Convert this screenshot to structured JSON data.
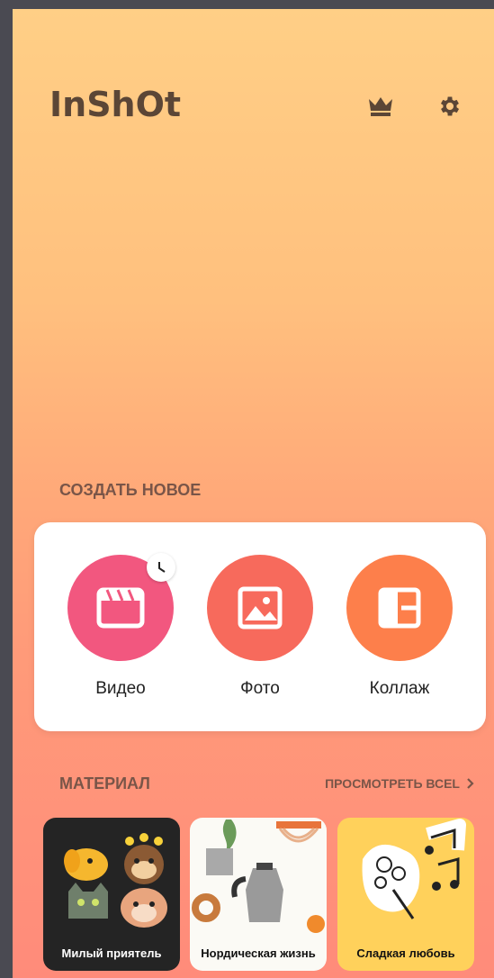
{
  "header": {
    "logo": "InShOt",
    "crown_icon": "crown-icon",
    "settings_icon": "gear-icon"
  },
  "create": {
    "title": "СОЗДАТЬ НОВОЕ",
    "items": [
      {
        "label": "Видео",
        "icon": "clapperboard-icon",
        "badge_icon": "clock-icon",
        "color": "#f2577f"
      },
      {
        "label": "Фото",
        "icon": "image-icon",
        "color": "#f76a5c"
      },
      {
        "label": "Коллаж",
        "icon": "collage-icon",
        "color": "#fd7f4b"
      }
    ]
  },
  "material": {
    "title": "МАТЕРИАЛ",
    "view_all": "ПРОСМОТРЕТЬ ВСЕL",
    "cards": [
      {
        "label": "Милый приятель"
      },
      {
        "label": "Нордическая жизнь"
      },
      {
        "label": "Сладкая любовь"
      }
    ]
  }
}
